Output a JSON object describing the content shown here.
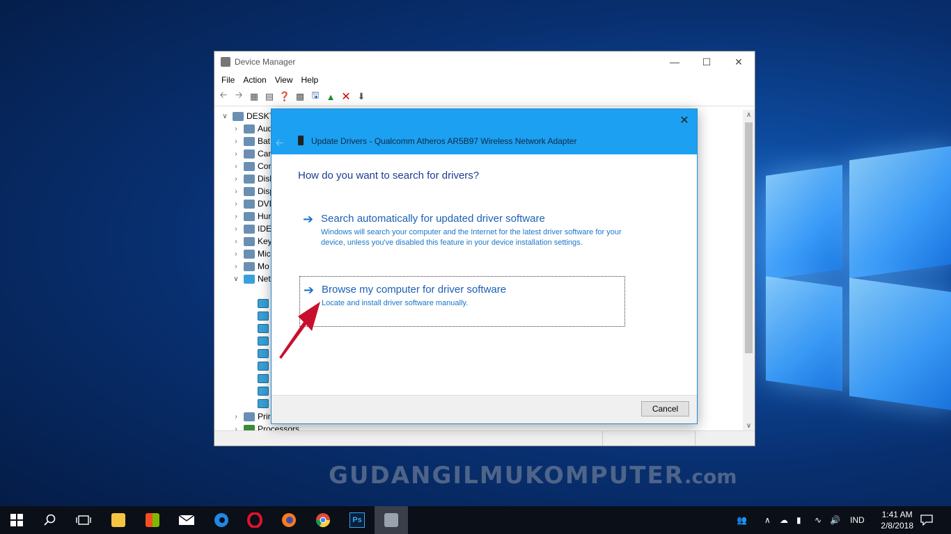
{
  "watermark": {
    "main": "GUDANGILMUKOMPUTER",
    "suffix": ".com"
  },
  "device_manager": {
    "title": "Device Manager",
    "menu": [
      "File",
      "Action",
      "View",
      "Help"
    ],
    "tree_root": "DESKTO",
    "tree_items": [
      "Aud",
      "Bat",
      "Car",
      "Cor",
      "Disl",
      "Disp",
      "DVD",
      "Hur",
      "IDE",
      "Key",
      "Mic",
      "Mo",
      "Net",
      "Prir",
      "Processors"
    ]
  },
  "dialog": {
    "title": "Update Drivers - Qualcomm Atheros AR5B97 Wireless Network Adapter",
    "heading": "How do you want to search for drivers?",
    "option1": {
      "title": "Search automatically for updated driver software",
      "desc": "Windows will search your computer and the Internet for the latest driver software for your device, unless you've disabled this feature in your device installation settings."
    },
    "option2": {
      "title": "Browse my computer for driver software",
      "desc": "Locate and install driver software manually."
    },
    "cancel": "Cancel"
  },
  "taskbar": {
    "language": "IND",
    "time": "1:41 AM",
    "date": "2/8/2018"
  },
  "colors": {
    "accent": "#1ca0f2",
    "link": "#1a5fb4",
    "arrow": "#c8102e"
  }
}
